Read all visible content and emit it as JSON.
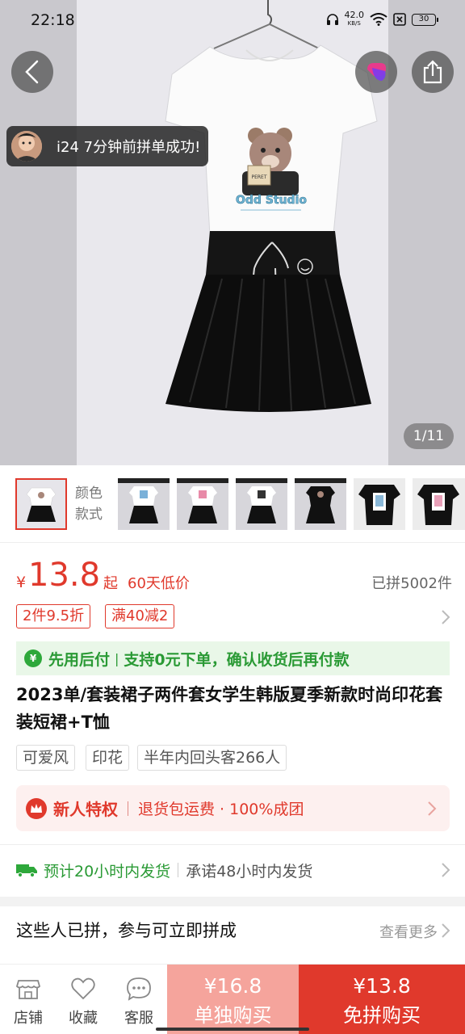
{
  "status_bar": {
    "time": "22:18",
    "net_speed_value": "42.0",
    "net_speed_unit": "KB/S",
    "battery": "30"
  },
  "hero": {
    "toast_text": "i24 7分钟前拼单成功!",
    "image_counter": "1/11",
    "shirt_print": "Odd Studio",
    "box_text": "PERET"
  },
  "thumbnails": {
    "variant_label_line1": "颜色",
    "variant_label_line2": "款式",
    "count": 8
  },
  "price": {
    "currency": "¥",
    "amount": "13.8",
    "suffix": "起",
    "note": "60天低价",
    "group_count": "已拼5002件"
  },
  "promos": [
    "2件9.5折",
    "满40减2"
  ],
  "pay_later": {
    "label": "先用后付",
    "desc": "支持0元下单，确认收货后再付款"
  },
  "product": {
    "title": "2023单/套装裙子两件套女学生韩版夏季新款时尚印花套装短裙+T恤"
  },
  "attributes": [
    "可爱风",
    "印花",
    "半年内回头客266人"
  ],
  "new_user": {
    "title": "新人特权",
    "desc": "退货包运费 · 100%成团"
  },
  "shipping": {
    "eta": "预计20小时内发货",
    "promise": "承诺48小时内发货"
  },
  "group_buy": {
    "title": "这些人已拼，参与可立即拼成",
    "see_more": "查看更多"
  },
  "bottom_bar": {
    "store_label": "店铺",
    "favorite_label": "收藏",
    "service_label": "客服",
    "solo_price": "¥16.8",
    "solo_label": "单独购买",
    "group_price": "¥13.8",
    "group_label": "免拼购买"
  },
  "colors": {
    "accent_red": "#e0392c",
    "solo_pink": "#f5a49c",
    "green": "#2a9a35"
  }
}
